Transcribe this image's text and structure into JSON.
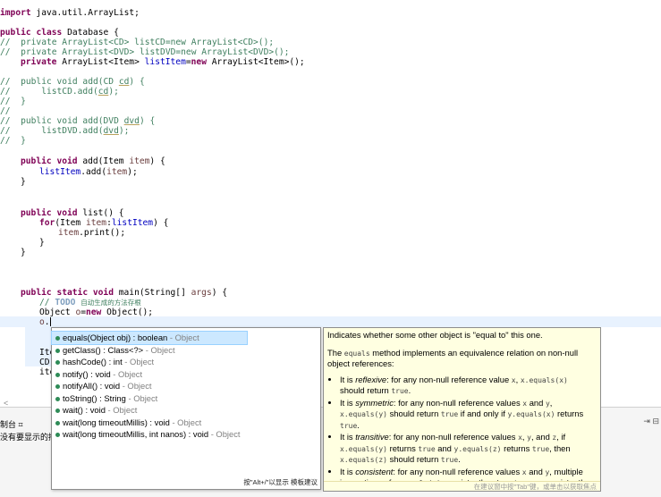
{
  "code": {
    "l1": [
      "import",
      " java.util.ArrayList;"
    ],
    "l2": [
      "public",
      " ",
      "class",
      " Database {"
    ],
    "l3": "//  private ArrayList<CD> listCD=new ArrayList<CD>();",
    "l4": "//  private ArrayList<DVD> listDVD=new ArrayList<DVD>();",
    "l5": [
      "private",
      " ArrayList<Item> ",
      "listItem",
      "=",
      "new",
      " ArrayList<Item>();"
    ],
    "l6": [
      "//  public void add(CD ",
      "cd",
      ") {"
    ],
    "l7": [
      "//      listCD.add(",
      "cd",
      ");"
    ],
    "l8": "//  }",
    "l9": "//",
    "l10": [
      "//  public void add(DVD ",
      "dvd",
      ") {"
    ],
    "l11": [
      "//      listDVD.add(",
      "dvd",
      ");"
    ],
    "l12": "//  }",
    "l13": [
      "public",
      " ",
      "void",
      " add(Item ",
      "item",
      ") {"
    ],
    "l14": [
      "listItem",
      ".add(",
      "item",
      ");"
    ],
    "l15": "}",
    "l16": [
      "public",
      " ",
      "void",
      " list() {"
    ],
    "l17": [
      "for",
      "(Item ",
      "item",
      ":",
      "listItem",
      ") {"
    ],
    "l18": [
      "item",
      ".print();"
    ],
    "l19": "}",
    "l20": "}",
    "l21": [
      "public",
      " ",
      "static",
      " ",
      "void",
      " main(String[] ",
      "args",
      ") {"
    ],
    "l22": [
      "// ",
      "TODO",
      " ",
      "自动生成的方法存根"
    ],
    "l23": [
      "Object ",
      "o",
      "=",
      "new",
      " Object();"
    ],
    "l24": [
      "o",
      "."
    ],
    "l25": "Ite",
    "l26": "CD ",
    "l27": "ite"
  },
  "proposals": {
    "items": [
      {
        "sig": "equals(Object obj) : boolean",
        "owner": " - Object"
      },
      {
        "sig": "getClass() : Class<?>",
        "owner": " - Object"
      },
      {
        "sig": "hashCode() : int",
        "owner": " - Object"
      },
      {
        "sig": "notify() : void",
        "owner": " - Object"
      },
      {
        "sig": "notifyAll() : void",
        "owner": " - Object"
      },
      {
        "sig": "toString() : String",
        "owner": " - Object"
      },
      {
        "sig": "wait() : void",
        "owner": " - Object"
      },
      {
        "sig": "wait(long timeoutMillis) : void",
        "owner": " - Object"
      },
      {
        "sig": "wait(long timeoutMillis, int nanos) : void",
        "owner": " - Object"
      }
    ],
    "footer": "按\"Alt+/\"以显示 模板建议"
  },
  "info": {
    "p1": "Indicates whether some other object is \"equal to\" this one.",
    "p2a": "The ",
    "p2code": "equals",
    "p2b": " method implements an equivalence relation on non-null object references:",
    "b1": [
      "It is ",
      "reflexive",
      ": for any non-null reference value ",
      "x",
      ", ",
      "x.equals(x)",
      " should return ",
      "true",
      "."
    ],
    "b2": [
      "It is ",
      "symmetric",
      ": for any non-null reference values ",
      "x",
      " and ",
      "y",
      ", ",
      "x.equals(y)",
      " should return ",
      "true",
      " if and only if ",
      "y.equals(x)",
      " returns ",
      "true",
      "."
    ],
    "b3": [
      "It is ",
      "transitive",
      ": for any non-null reference values ",
      "x",
      ", ",
      "y",
      ", and ",
      "z",
      ", if ",
      "x.equals(y)",
      " returns ",
      "true",
      " and ",
      "y.equals(z)",
      " returns ",
      "true",
      ", then ",
      "x.equals(z)",
      " should return ",
      "true",
      "."
    ],
    "b4": [
      "It is ",
      "consistent",
      ": for any non-null reference values ",
      "x",
      " and ",
      "y",
      ", multiple invocations of ",
      "x.equals(y)",
      " consistently return ",
      "true",
      " or consistently return ",
      "false",
      ", provided no information used in ",
      "equals"
    ],
    "footer": "在建议窗中按\"Tab\"键，或单击以获取焦点"
  },
  "console": {
    "tab": "制台 ⌗",
    "text": "没有要显示的控",
    "scroll_left": "<",
    "right_icons": "⇥ ⊟"
  }
}
